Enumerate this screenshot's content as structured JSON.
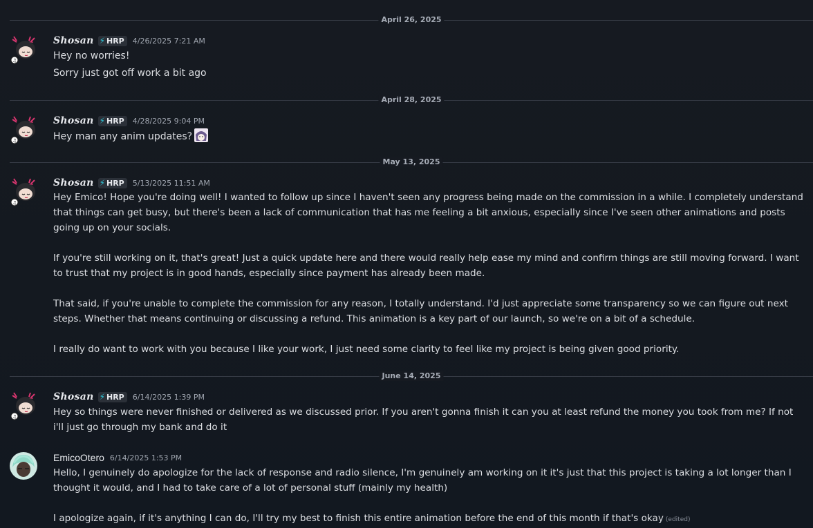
{
  "dividers": [
    "April 26, 2025",
    "April 28, 2025",
    "May 13, 2025",
    "June 14, 2025"
  ],
  "messages": [
    {
      "user": "Shosan",
      "tag": "HRP",
      "time": "4/26/2025 7:21 AM",
      "lines": [
        "Hey no worries!",
        "Sorry just got off work a bit ago"
      ]
    },
    {
      "user": "Shosan",
      "tag": "HRP",
      "time": "4/28/2025 9:04 PM",
      "text": "Hey man any anim updates?"
    },
    {
      "user": "Shosan",
      "tag": "HRP",
      "time": "5/13/2025 11:51 AM",
      "paragraphs": [
        "Hey Emico! Hope you're doing well! I wanted to follow up since I haven't seen any progress being made on the commission in a while. I completely understand that things can get busy, but there's been a lack of communication that has me feeling a bit anxious, especially since I've seen other animations and posts going up on your socials.",
        "If you're still working on it, that's great! Just a quick update here and there would really help ease my mind and confirm things are still moving forward. I want to trust that my project is in good hands, especially since payment has already been made.",
        "That said, if you're unable to complete the commission for any reason, I totally understand. I'd just appreciate some transparency so we can figure out next steps. Whether that means continuing or discussing a refund. This animation is a key part of our launch, so we're on a bit of a schedule.",
        "I really do want to work with you because I like your work, I just need some clarity to feel like my project is being given good priority."
      ]
    },
    {
      "user": "Shosan",
      "tag": "HRP",
      "time": "6/14/2025 1:39 PM",
      "text": "Hey so things were never finished or delivered as we discussed prior. If you aren't gonna finish it can you at least refund the money you took from me? If not i'll just go through my bank and do it"
    },
    {
      "user": "EmicoOtero",
      "time": "6/14/2025 1:53 PM",
      "paragraphs": [
        "Hello, I genuinely do apologize for the lack of response and radio silence, I'm genuinely am working on it it's just that this project is taking a lot longer than I thought it would, and I had to take care of a lot of personal stuff (mainly my health)",
        "I apologize again, if it's anything I can do, I'll try my best to finish this entire animation before the end of this month if that's okay"
      ],
      "edited": "(edited)"
    }
  ],
  "colors": {
    "background": "#161a21",
    "text": "#dcdee2",
    "timestamp": "#a0a6b0",
    "tag_bolt": "#2fc7d8",
    "divider": "#353a44"
  },
  "icons": {
    "shosan_avatar": "anime-girl-avatar-icon",
    "emico_avatar": "teal-hair-avatar-icon",
    "tag_icon": "lightning-bolt-icon",
    "emoji": "anime-face-emoji-icon"
  }
}
